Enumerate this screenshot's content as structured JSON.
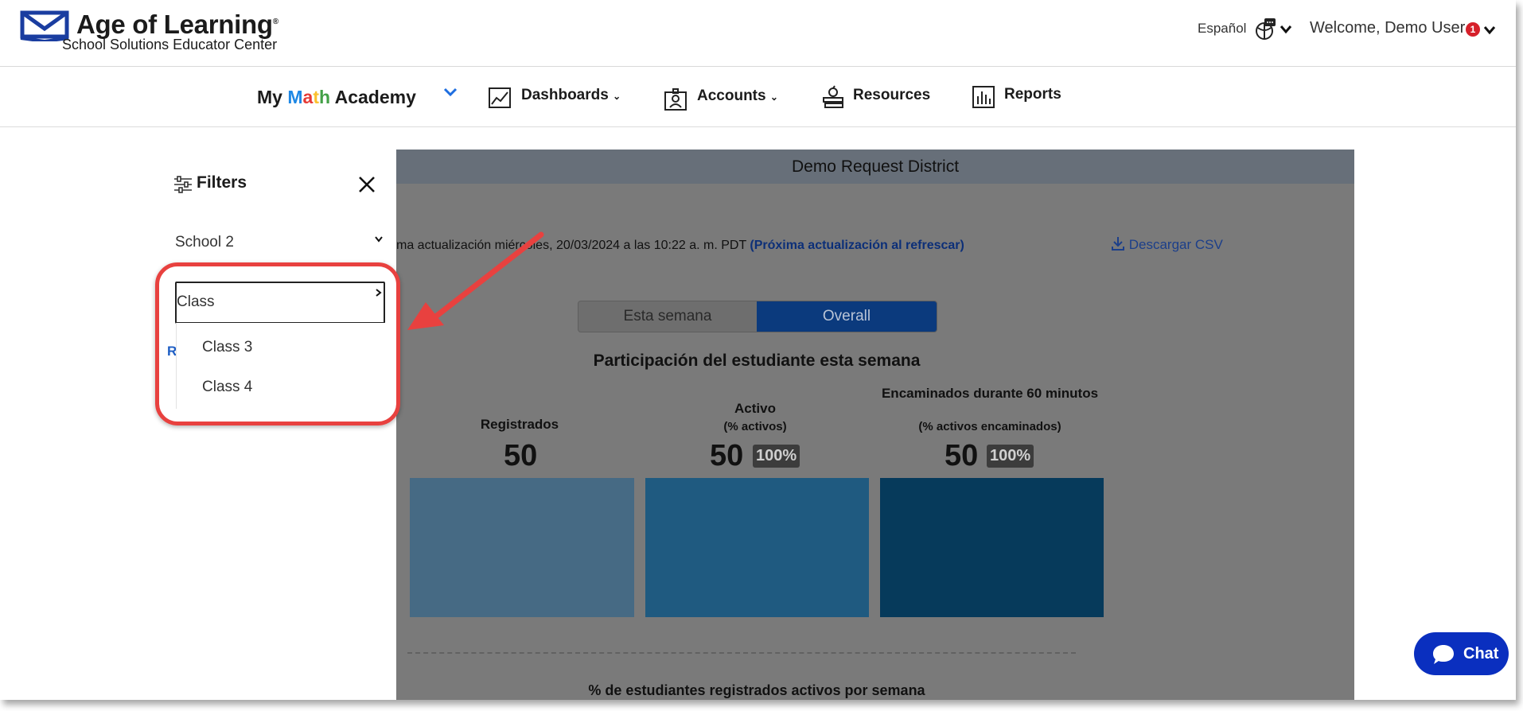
{
  "header": {
    "brand_title": "Age of Learning",
    "brand_registered": "®",
    "brand_subtitle": "School Solutions Educator Center",
    "language_label": "Español",
    "welcome_text": "Welcome, Demo User",
    "notification_count": "1",
    "icons": [
      "aol-logo-icon",
      "language-globe-icon",
      "chevron-down-icon"
    ]
  },
  "nav": {
    "product_prefix": "My ",
    "product_m": "M",
    "product_a": "a",
    "product_t": "t",
    "product_h": "h",
    "product_suffix": " Academy",
    "items": [
      {
        "label": "Dashboards",
        "icon": "line-chart-icon"
      },
      {
        "label": "Accounts",
        "icon": "id-card-icon"
      },
      {
        "label": "Resources",
        "icon": "books-apple-icon"
      },
      {
        "label": "Reports",
        "icon": "bar-chart-icon"
      }
    ]
  },
  "filters": {
    "title": "Filters",
    "school_value": "School 2",
    "class_value": "Class",
    "partial_link": "R",
    "options": [
      "Class 3",
      "Class 4"
    ]
  },
  "content": {
    "district": "Demo Request District",
    "update_text": "ma actualización miércoles, 20/03/2024 a las 10:22 a. m. PDT ",
    "update_link": "(Próxima actualización al refrescar)",
    "download_label": "Descargar CSV",
    "segment": [
      "Esta semana",
      "Overall"
    ],
    "chart_title": "Participación del estudiante esta semana",
    "bottom_title": "% de estudiantes registrados activos por semana"
  },
  "chart_data": {
    "type": "bar",
    "title": "Participación del estudiante esta semana",
    "categories": [
      "Registrados",
      "Activo",
      "Encaminados durante 60 minutos"
    ],
    "subtitles": [
      "",
      "(% activos)",
      "(% activos encaminados)"
    ],
    "values": [
      50,
      50,
      50
    ],
    "percent_labels": [
      "",
      "100%",
      "100%"
    ],
    "colors": [
      "#466a84",
      "#1f5a80",
      "#063a5b"
    ]
  },
  "chat": {
    "label": "Chat"
  },
  "annotation": {
    "color": "#e8413f"
  }
}
